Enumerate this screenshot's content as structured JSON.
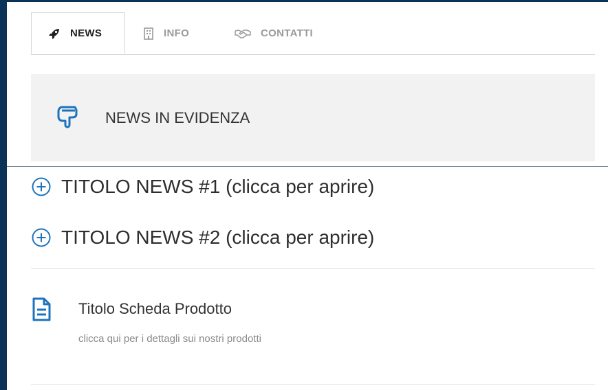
{
  "tabs": [
    {
      "label": "NEWS",
      "icon": "rocket-icon",
      "active": true
    },
    {
      "label": "INFO",
      "icon": "building-icon",
      "active": false
    },
    {
      "label": "CONTATTI",
      "icon": "handshake-icon",
      "active": false
    }
  ],
  "featured": {
    "label": "NEWS IN EVIDENZA",
    "icon": "pointing-hand-icon"
  },
  "accordion": [
    {
      "title": "TITOLO NEWS #1 (clicca per aprire)",
      "icon": "plus-circle-icon"
    },
    {
      "title": "TITOLO NEWS #2 (clicca per aprire)",
      "icon": "plus-circle-icon"
    }
  ],
  "product": {
    "title": "Titolo Scheda Prodotto",
    "description": "clicca qui per i dettagli sui nostri prodotti",
    "icon": "document-icon"
  },
  "colors": {
    "accent": "#1e73be",
    "page_border": "#0b3358",
    "featured_bg": "#f2f2f2"
  }
}
